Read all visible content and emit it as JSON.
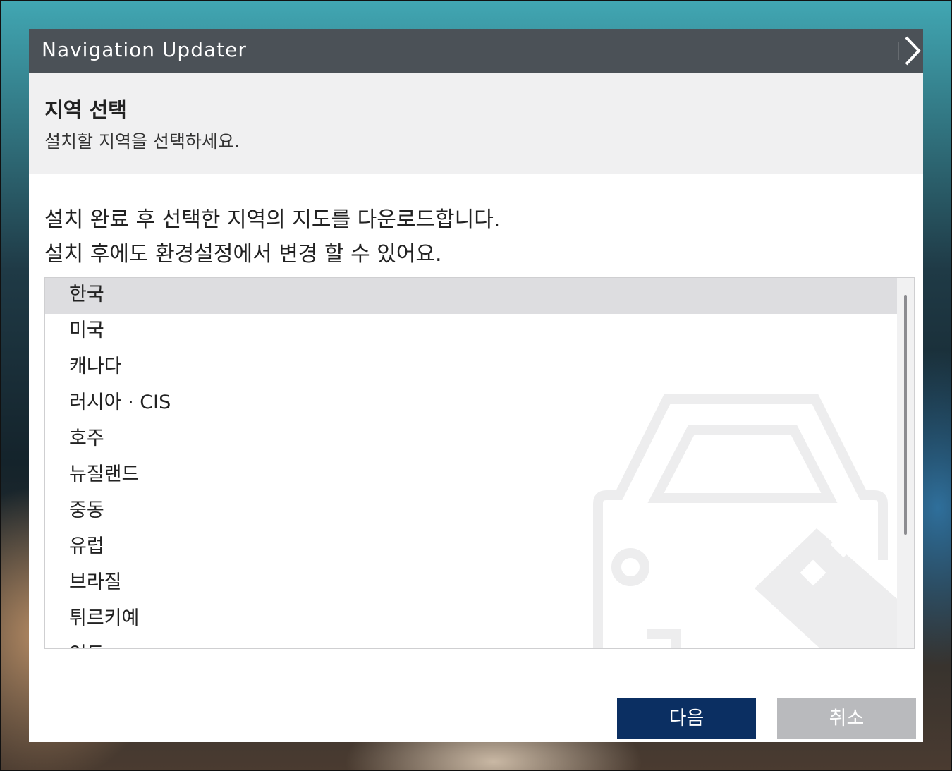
{
  "window": {
    "title": "Navigation Updater",
    "close_icon": "chevron-right-icon"
  },
  "header": {
    "title": "지역 선택",
    "subtitle": "설치할 지역을 선택하세요."
  },
  "intro": {
    "line1": "설치 완료 후 선택한 지역의 지도를 다운로드합니다.",
    "line2": "설치 후에도 환경설정에서 변경 할 수 있어요."
  },
  "regions": {
    "selected": "한국",
    "items": [
      {
        "label": "한국"
      },
      {
        "label": "미국"
      },
      {
        "label": "캐나다"
      },
      {
        "label": "러시아 · CIS"
      },
      {
        "label": "호주"
      },
      {
        "label": "뉴질랜드"
      },
      {
        "label": "중동"
      },
      {
        "label": "유럽"
      },
      {
        "label": "브라질"
      },
      {
        "label": "튀르키예"
      },
      {
        "label": "인도"
      }
    ]
  },
  "buttons": {
    "next_label": "다음",
    "cancel_label": "취소"
  },
  "colors": {
    "titlebar": "#4b5157",
    "header_band": "#f0f0f1",
    "selected_row": "#dddde0",
    "primary_button": "#0b2f62",
    "secondary_button": "#b9babd"
  },
  "icons": {
    "watermark": "car-icon"
  }
}
